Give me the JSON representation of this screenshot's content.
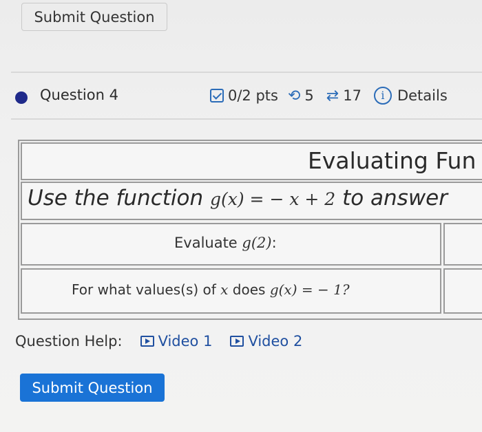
{
  "top": {
    "submit_label": "Submit Question"
  },
  "question": {
    "title": "Question 4",
    "points": "0/2 pts",
    "retries": "5",
    "attempts": "17",
    "details_label": "Details"
  },
  "table": {
    "heading": "Evaluating Fun",
    "instruction_prefix": "Use the function",
    "instruction_g": "g(x) = ",
    "instruction_rhs": "− x + 2",
    "instruction_suffix": "to answer",
    "row1_label": "Evaluate ",
    "row1_math": "g(2)",
    "row1_colon": ":",
    "row2_prefix": "For what values(s) of ",
    "row2_var": "x",
    "row2_mid": " does ",
    "row2_math": "g(x) = − 1",
    "row2_q": "?"
  },
  "help": {
    "label": "Question Help:",
    "video1": "Video 1",
    "video2": "Video 2"
  },
  "bottom": {
    "submit_label": "Submit Question"
  },
  "colors": {
    "accent": "#1a73d6",
    "link": "#1f4fa0",
    "bullet": "#1f2a8a"
  }
}
